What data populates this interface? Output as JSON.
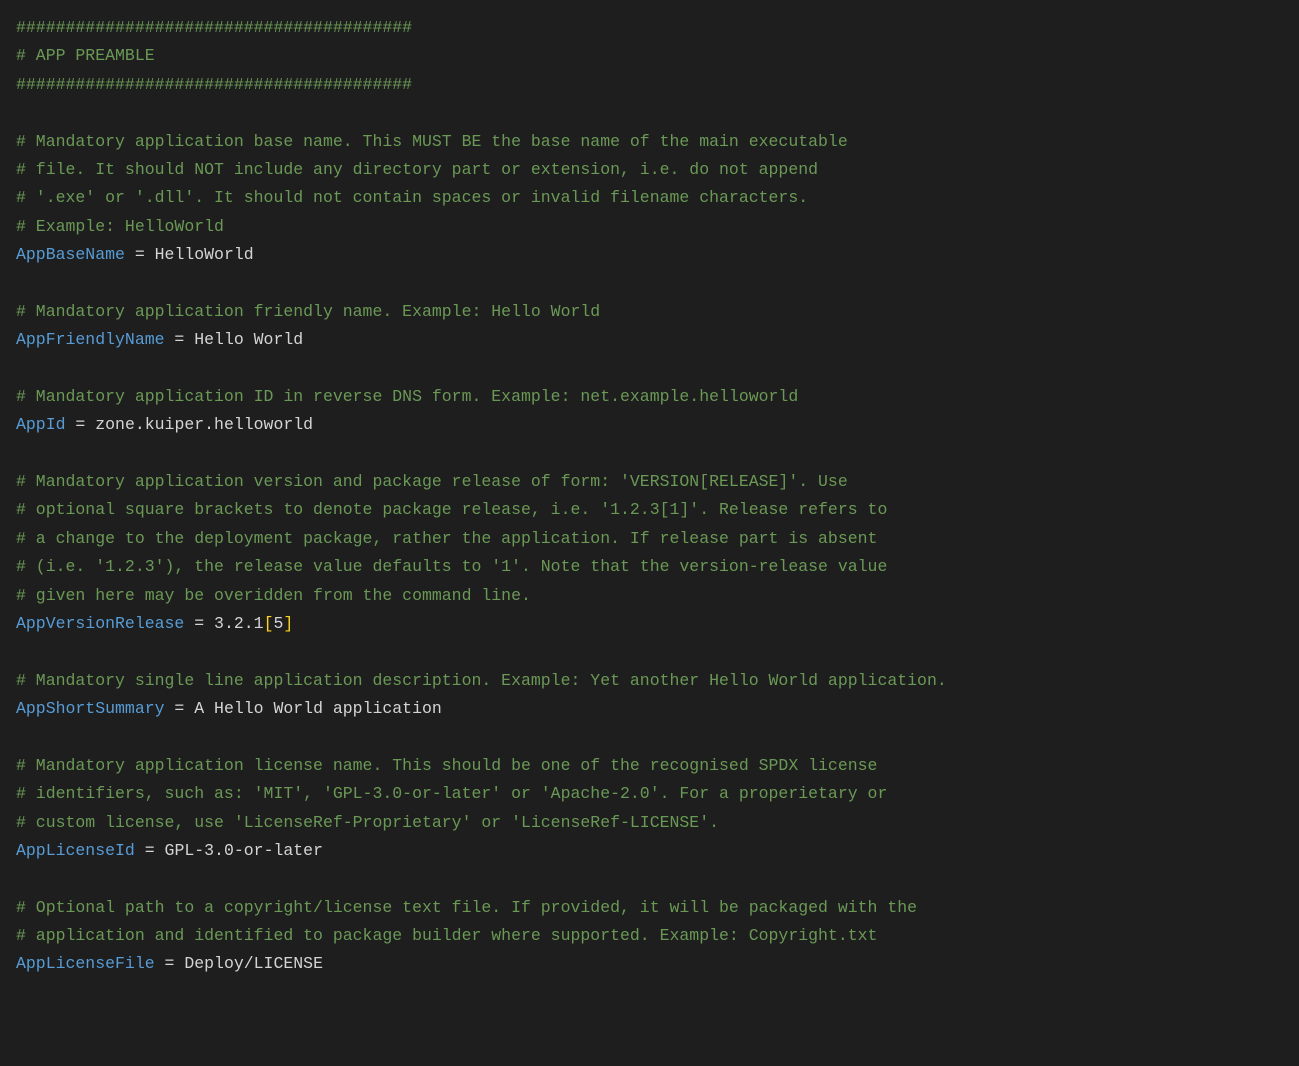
{
  "hash_line": "########################################",
  "preamble_label": "# APP PREAMBLE",
  "equals": " = ",
  "comments": {
    "base_name": [
      "# Mandatory application base name. This MUST BE the base name of the main executable",
      "# file. It should NOT include any directory part or extension, i.e. do not append",
      "# '.exe' or '.dll'. It should not contain spaces or invalid filename characters.",
      "# Example: HelloWorld"
    ],
    "friendly_name": [
      "# Mandatory application friendly name. Example: Hello World"
    ],
    "app_id": [
      "# Mandatory application ID in reverse DNS form. Example: net.example.helloworld"
    ],
    "version": [
      "# Mandatory application version and package release of form: 'VERSION[RELEASE]'. Use",
      "# optional square brackets to denote package release, i.e. '1.2.3[1]'. Release refers to",
      "# a change to the deployment package, rather the application. If release part is absent",
      "# (i.e. '1.2.3'), the release value defaults to '1'. Note that the version-release value",
      "# given here may be overidden from the command line."
    ],
    "summary": [
      "# Mandatory single line application description. Example: Yet another Hello World application."
    ],
    "license_id": [
      "# Mandatory application license name. This should be one of the recognised SPDX license",
      "# identifiers, such as: 'MIT', 'GPL-3.0-or-later' or 'Apache-2.0'. For a properietary or",
      "# custom license, use 'LicenseRef-Proprietary' or 'LicenseRef-LICENSE'."
    ],
    "license_file": [
      "# Optional path to a copyright/license text file. If provided, it will be packaged with the",
      "# application and identified to package builder where supported. Example: Copyright.txt"
    ]
  },
  "entries": {
    "AppBaseName": "HelloWorld",
    "AppFriendlyName": "Hello World",
    "AppId": "zone.kuiper.helloworld",
    "AppVersionRelease_version": "3.2.1",
    "AppVersionRelease_lbr": "[",
    "AppVersionRelease_release": "5",
    "AppVersionRelease_rbr": "]",
    "AppShortSummary": "A Hello World application",
    "AppLicenseId": "GPL-3.0-or-later",
    "AppLicenseFile": "Deploy/LICENSE"
  },
  "keys": {
    "AppBaseName": "AppBaseName",
    "AppFriendlyName": "AppFriendlyName",
    "AppId": "AppId",
    "AppVersionRelease": "AppVersionRelease",
    "AppShortSummary": "AppShortSummary",
    "AppLicenseId": "AppLicenseId",
    "AppLicenseFile": "AppLicenseFile"
  }
}
